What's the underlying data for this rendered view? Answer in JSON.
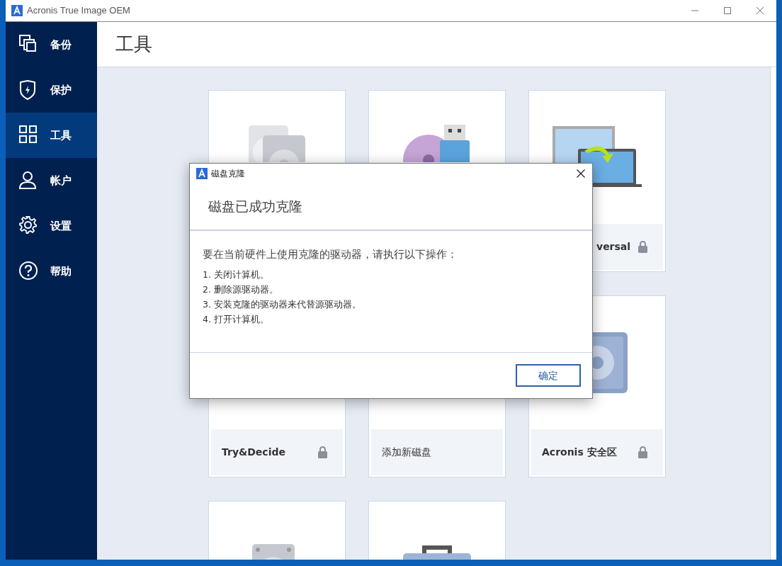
{
  "window": {
    "title": "Acronis True Image OEM"
  },
  "sidebar": {
    "items": [
      {
        "label": "备份",
        "selected": false
      },
      {
        "label": "保护",
        "selected": false
      },
      {
        "label": "工具",
        "selected": true
      },
      {
        "label": "帐户",
        "selected": false
      },
      {
        "label": "设置",
        "selected": false
      },
      {
        "label": "帮助",
        "selected": false
      }
    ]
  },
  "page_title": "工具",
  "cards": [
    {
      "kind": "drives"
    },
    {
      "kind": "media"
    },
    {
      "kind": "laptops",
      "label": "versal",
      "locked": true,
      "clipped": true
    },
    {
      "label": "Try&Decide",
      "locked": true
    },
    {
      "label": "添加新磁盘",
      "locked": false
    },
    {
      "kind": "safe",
      "label": "Acronis 安全区",
      "locked": true
    },
    {
      "kind": "drive"
    },
    {
      "kind": "toolbox"
    }
  ],
  "dialog": {
    "title": "磁盘克隆",
    "heading": "磁盘已成功克隆",
    "intro": "要在当前硬件上使用克隆的驱动器，请执行以下操作：",
    "steps": [
      "1. 关闭计算机。",
      "2. 删除源驱动器。",
      "3. 安装克隆的驱动器来代替源驱动器。",
      "4. 打开计算机。"
    ],
    "ok_button": "确定"
  }
}
